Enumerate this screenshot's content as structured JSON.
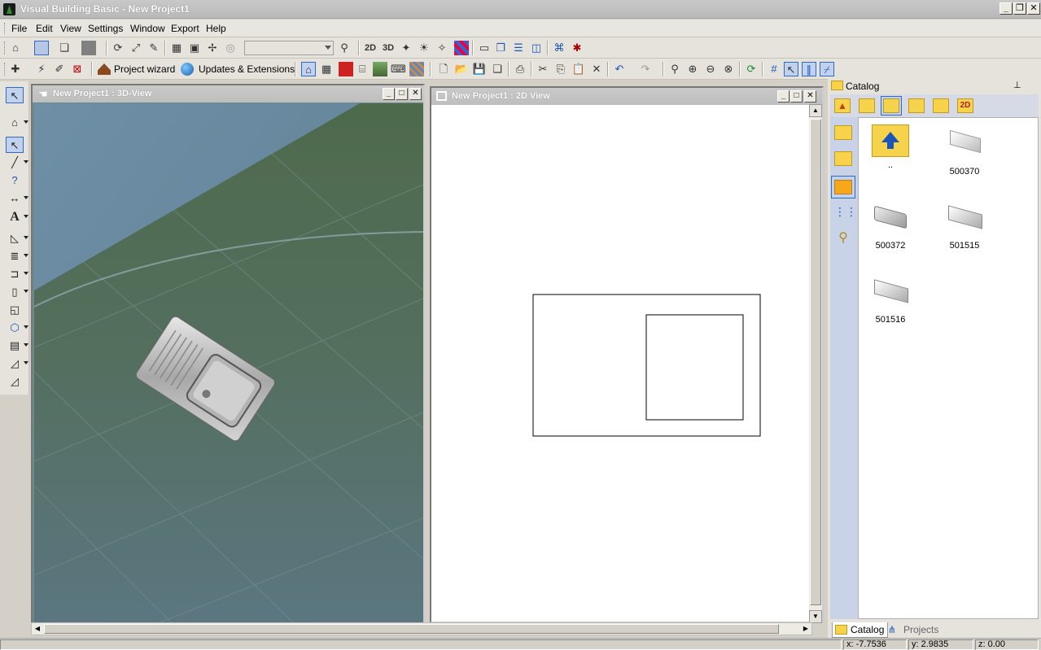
{
  "window": {
    "title": "Visual Building Basic - New Project1",
    "minimize": "_",
    "restore": "❐",
    "close": "✕"
  },
  "menu": [
    "File",
    "Edit",
    "View",
    "Settings",
    "Window",
    "Export",
    "Help"
  ],
  "toolbar1": {
    "layer_select_value": "",
    "btn_2d": "2D",
    "btn_3d": "3D"
  },
  "toolbar2": {
    "project_wizard": "Project wizard",
    "updates": "Updates & Extensions"
  },
  "view3d": {
    "title": "New Project1 : 3D-View"
  },
  "view2d": {
    "title": "New Project1 : 2D View"
  },
  "catalog": {
    "title": "Catalog",
    "items": [
      {
        "label": "..",
        "icon": "folder-up-icon"
      },
      {
        "label": "500370",
        "icon": "sink-thumb-icon"
      },
      {
        "label": "500372",
        "icon": "sink-thumb-icon"
      },
      {
        "label": "501515",
        "icon": "sink-thumb-icon"
      },
      {
        "label": "501516",
        "icon": "sink-thumb-icon"
      }
    ],
    "tabs": [
      {
        "label": "Catalog",
        "icon": "folder-icon"
      },
      {
        "label": "Projects",
        "icon": "tree-icon"
      }
    ],
    "side_labels": [
      "2D"
    ]
  },
  "status": {
    "x": "x: -7.7536",
    "y": "y: 2.9835",
    "z": "z: 0.00"
  },
  "colors": {
    "ground": "#5c7a6a",
    "accent_blue": "#316ac5",
    "folder_yellow": "#f6d34a"
  }
}
